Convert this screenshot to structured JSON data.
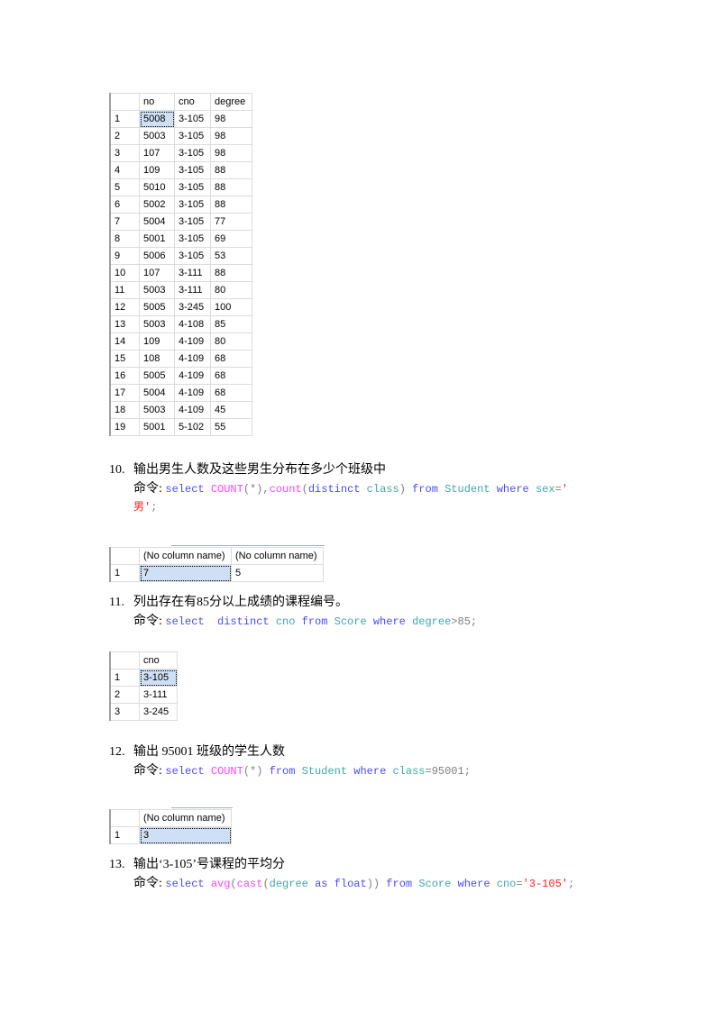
{
  "table1": {
    "columns": [
      "no",
      "cno",
      "degree"
    ],
    "rows": [
      [
        "1",
        "5008",
        "3-105",
        "98"
      ],
      [
        "2",
        "5003",
        "3-105",
        "98"
      ],
      [
        "3",
        "107",
        "3-105",
        "98"
      ],
      [
        "4",
        "109",
        "3-105",
        "88"
      ],
      [
        "5",
        "5010",
        "3-105",
        "88"
      ],
      [
        "6",
        "5002",
        "3-105",
        "88"
      ],
      [
        "7",
        "5004",
        "3-105",
        "77"
      ],
      [
        "8",
        "5001",
        "3-105",
        "69"
      ],
      [
        "9",
        "5006",
        "3-105",
        "53"
      ],
      [
        "10",
        "107",
        "3-111",
        "88"
      ],
      [
        "11",
        "5003",
        "3-111",
        "80"
      ],
      [
        "12",
        "5005",
        "3-245",
        "100"
      ],
      [
        "13",
        "5003",
        "4-108",
        "85"
      ],
      [
        "14",
        "109",
        "4-109",
        "80"
      ],
      [
        "15",
        "108",
        "4-109",
        "68"
      ],
      [
        "16",
        "5005",
        "4-109",
        "68"
      ],
      [
        "17",
        "5004",
        "4-109",
        "68"
      ],
      [
        "18",
        "5003",
        "4-109",
        "45"
      ],
      [
        "19",
        "5001",
        "5-102",
        "55"
      ]
    ]
  },
  "q10": {
    "number": "10.",
    "text": "输出男生人数及这些男生分布在多少个班级中",
    "cmd_label": "命令:",
    "code": [
      {
        "t": "select ",
        "c": "kw"
      },
      {
        "t": "COUNT",
        "c": "fn"
      },
      {
        "t": "(*),",
        "c": "gr"
      },
      {
        "t": "count",
        "c": "fn"
      },
      {
        "t": "(",
        "c": "gr"
      },
      {
        "t": "distinct ",
        "c": "kw"
      },
      {
        "t": "class",
        "c": "id"
      },
      {
        "t": ") ",
        "c": "gr"
      },
      {
        "t": "from ",
        "c": "kw"
      },
      {
        "t": "Student ",
        "c": "id"
      },
      {
        "t": "where ",
        "c": "kw"
      },
      {
        "t": "sex",
        "c": "id"
      },
      {
        "t": "=",
        "c": "gr"
      },
      {
        "t": "'",
        "c": "str"
      }
    ],
    "code_line2": [
      {
        "t": "男'",
        "c": "str"
      },
      {
        "t": ";",
        "c": "gr"
      }
    ],
    "result": {
      "columns": [
        "(No column name)",
        "(No column name)"
      ],
      "rows": [
        [
          "1",
          "7",
          "5"
        ]
      ]
    }
  },
  "q11": {
    "number": "11.",
    "text": "列出存在有85分以上成绩的课程编号。",
    "cmd_label": "命令:",
    "code": [
      {
        "t": "select  ",
        "c": "kw"
      },
      {
        "t": "distinct ",
        "c": "kw"
      },
      {
        "t": "cno ",
        "c": "id"
      },
      {
        "t": "from ",
        "c": "kw"
      },
      {
        "t": "Score ",
        "c": "id"
      },
      {
        "t": "where ",
        "c": "kw"
      },
      {
        "t": "degree",
        "c": "id"
      },
      {
        "t": ">85;",
        "c": "gr"
      }
    ],
    "result": {
      "columns": [
        "cno"
      ],
      "rows": [
        [
          "1",
          "3-105"
        ],
        [
          "2",
          "3-111"
        ],
        [
          "3",
          "3-245"
        ]
      ]
    }
  },
  "q12": {
    "number": "12.",
    "text": "输出 95001 班级的学生人数",
    "cmd_label": "命令:",
    "code": [
      {
        "t": "select ",
        "c": "kw"
      },
      {
        "t": "COUNT",
        "c": "fn"
      },
      {
        "t": "(*) ",
        "c": "gr"
      },
      {
        "t": "from ",
        "c": "kw"
      },
      {
        "t": "Student ",
        "c": "id"
      },
      {
        "t": "where ",
        "c": "kw"
      },
      {
        "t": "class",
        "c": "id"
      },
      {
        "t": "=95001;",
        "c": "gr"
      }
    ],
    "result": {
      "columns": [
        "(No column name)"
      ],
      "rows": [
        [
          "1",
          "3"
        ]
      ]
    }
  },
  "q13": {
    "number": "13.",
    "text": "输出‘3-105’号课程的平均分",
    "cmd_label": "命令:",
    "code": [
      {
        "t": "select ",
        "c": "kw"
      },
      {
        "t": "avg",
        "c": "fn"
      },
      {
        "t": "(",
        "c": "gr"
      },
      {
        "t": "cast",
        "c": "fn"
      },
      {
        "t": "(",
        "c": "gr"
      },
      {
        "t": "degree ",
        "c": "id"
      },
      {
        "t": "as ",
        "c": "kw"
      },
      {
        "t": "float",
        "c": "kw"
      },
      {
        "t": ")) ",
        "c": "gr"
      },
      {
        "t": "from ",
        "c": "kw"
      },
      {
        "t": "Score ",
        "c": "id"
      },
      {
        "t": "where ",
        "c": "kw"
      },
      {
        "t": "cno",
        "c": "id"
      },
      {
        "t": "=",
        "c": "gr"
      },
      {
        "t": "'3-105'",
        "c": "str"
      },
      {
        "t": ";",
        "c": "gr"
      }
    ]
  }
}
